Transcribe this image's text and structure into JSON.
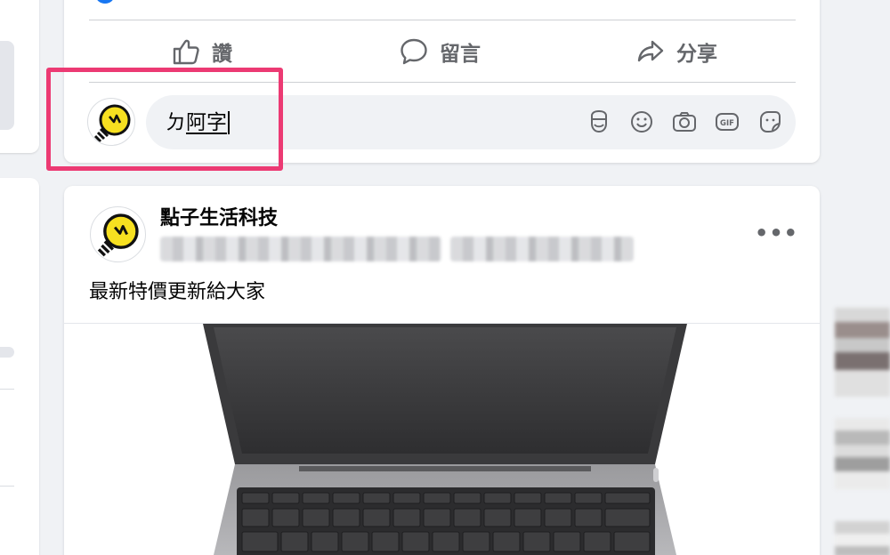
{
  "actions": {
    "like_label": "讚",
    "comment_label": "留言",
    "share_label": "分享"
  },
  "comment": {
    "composing_char": "ㄉ",
    "typed_text": "阿字",
    "icons": [
      "avatar-sticker-icon",
      "emoji-icon",
      "camera-icon",
      "gif-icon",
      "sticker-icon"
    ],
    "gif_label": "GIF"
  },
  "post": {
    "page_name": "點子生活科技",
    "more_label": "•••",
    "text": "最新特價更新給大家"
  },
  "colors": {
    "highlight": "#ec3a73",
    "avatar_yellow": "#f7e020",
    "icon_gray": "#65676b"
  }
}
